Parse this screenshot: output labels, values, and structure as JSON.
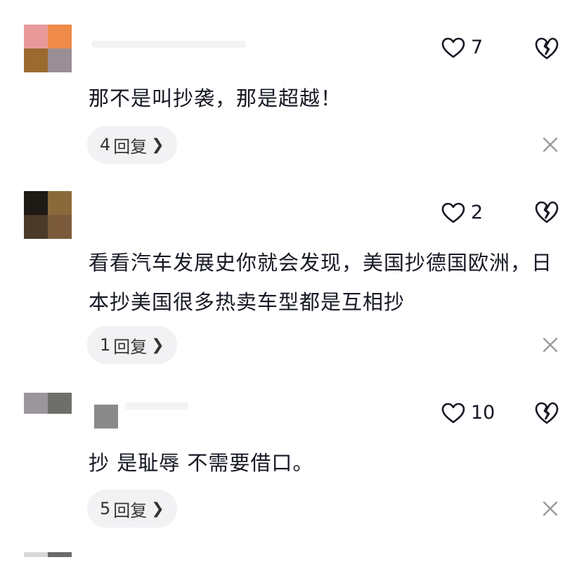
{
  "comments": [
    {
      "likes": "7",
      "text": "那不是叫抄袭，那是超越！",
      "reply_count": "4",
      "reply_label": "回复",
      "avatar_colors": [
        "#e89a9a",
        "#ef8a48",
        "#9a6a2e",
        "#9a8e94"
      ]
    },
    {
      "likes": "2",
      "text": "看看汽车发展史你就会发现，美国抄德国欧洲，日本抄美国很多热卖车型都是互相抄",
      "reply_count": "1",
      "reply_label": "回复",
      "avatar_colors": [
        "#1e1a16",
        "#8a6a3a",
        "#4a3a2a",
        "#7a5a3a"
      ]
    },
    {
      "likes": "10",
      "text": "抄 是耻辱 不需要借口。",
      "reply_count": "5",
      "reply_label": "回复",
      "avatar_colors": [
        "#9a969c",
        "#6e6e6a",
        "#ffffff",
        "#ffffff"
      ]
    }
  ],
  "icons": {
    "like": "heart-outline-icon",
    "dislike": "broken-heart-icon",
    "close": "close-icon",
    "chevron": "chevron-right-icon"
  },
  "colors": {
    "text": "#161823",
    "pill_bg": "#f2f2f4",
    "icon": "#161823",
    "close": "#9a9a9a"
  }
}
